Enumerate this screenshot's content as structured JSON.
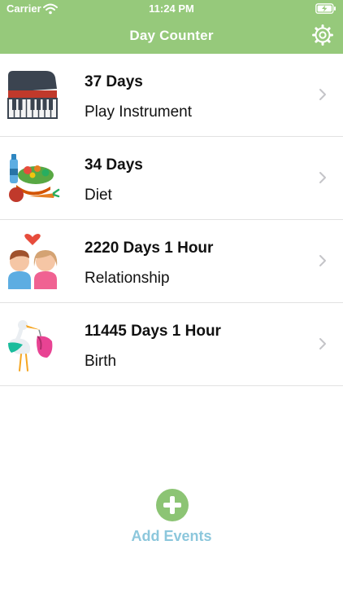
{
  "status_bar": {
    "carrier": "Carrier",
    "time": "11:24 PM",
    "wifi_icon": "wifi-icon",
    "battery_icon": "battery-charging-icon"
  },
  "nav": {
    "title": "Day Counter",
    "settings_icon": "gear-icon"
  },
  "colors": {
    "header": "#96c97b",
    "add_button": "#8cc474",
    "add_label": "#8cc7dc",
    "divider": "#e2e2e2"
  },
  "events": [
    {
      "days": "37 Days",
      "label": "Play Instrument",
      "icon": "piano-icon"
    },
    {
      "days": "34 Days",
      "label": "Diet",
      "icon": "vegetables-icon"
    },
    {
      "days": "2220 Days 1 Hour",
      "label": "Relationship",
      "icon": "couple-icon"
    },
    {
      "days": "11445 Days 1 Hour",
      "label": "Birth",
      "icon": "stork-icon"
    }
  ],
  "add": {
    "label": "Add Events",
    "icon": "plus-circle-icon"
  }
}
